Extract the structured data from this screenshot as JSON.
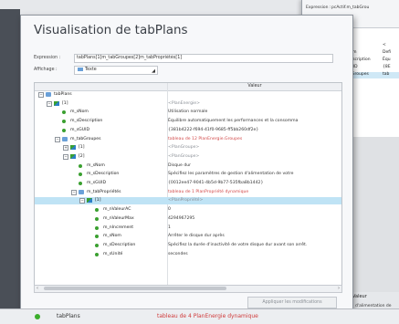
{
  "back_dialog": {
    "expression_label": "Expression :",
    "expression_value": "pcActif.m_tabGrou",
    "affichage_label": "Affichage :",
    "affichage_value": "Texte",
    "rows": [
      {
        "name": "pcActif",
        "value": "<"
      },
      {
        "name": "m_sNom",
        "value": "Defi"
      },
      {
        "name": "m_sDescription",
        "value": "Équ"
      },
      {
        "name": "m_sGUID",
        "value": "{8E"
      },
      {
        "name": "m_tabGroupes",
        "value": "tab"
      }
    ],
    "footer_header": "Valeur",
    "footer_text": "d'alimentation de"
  },
  "dialog": {
    "title": "Visualisation de tabPlans",
    "expression_label": "Expression :",
    "expression_value": "tabPlans[1]m_tabGroupes[2]m_tabPropriétés[1]",
    "affichage_label": "Affichage :",
    "affichage_value": "Texte",
    "col_name": "",
    "col_value": "Valeur",
    "rows": [
      {
        "indent": 0,
        "toggle": "−",
        "icon": "folder",
        "name": "tabPlans",
        "value": "",
        "vclass": ""
      },
      {
        "indent": 1,
        "toggle": "−",
        "icon": "link",
        "name": "[1]",
        "value": "<PlanEnergie>",
        "vclass": "gray"
      },
      {
        "indent": 2,
        "toggle": "",
        "icon": "dot",
        "name": "m_sNom",
        "value": "Utilisation normale",
        "vclass": ""
      },
      {
        "indent": 2,
        "toggle": "",
        "icon": "dot",
        "name": "m_sDescription",
        "value": "Équilibre automatiquement les performances et la consomma",
        "vclass": ""
      },
      {
        "indent": 2,
        "toggle": "",
        "icon": "dot",
        "name": "m_sGUID",
        "value": "{381b4222-f694-41f0-9685-ff5bb260df2e}",
        "vclass": ""
      },
      {
        "indent": 2,
        "toggle": "−",
        "icon": "folder",
        "name": "m_tabGroupes",
        "value": "tableau de 12 PlanEnergie.Groupes",
        "vclass": "red"
      },
      {
        "indent": 3,
        "toggle": "+",
        "icon": "link",
        "name": "[1]",
        "value": "<PlanGroupe>",
        "vclass": "gray"
      },
      {
        "indent": 3,
        "toggle": "−",
        "icon": "link",
        "name": "[2]",
        "value": "<PlanGroupe>",
        "vclass": "gray"
      },
      {
        "indent": 4,
        "toggle": "",
        "icon": "dot",
        "name": "m_sNom",
        "value": "Disque dur",
        "vclass": ""
      },
      {
        "indent": 4,
        "toggle": "",
        "icon": "dot",
        "name": "m_sDescription",
        "value": "Spécifiez les paramètres de gestion d'alimentation de votre",
        "vclass": ""
      },
      {
        "indent": 4,
        "toggle": "",
        "icon": "dot",
        "name": "m_sGUID",
        "value": "{0012ee47-9041-4b5d-9b77-535fba8b1442}",
        "vclass": ""
      },
      {
        "indent": 4,
        "toggle": "−",
        "icon": "folder",
        "name": "m_tabPropriétés",
        "value": "tableau de 1 PlanPropriété dynamique",
        "vclass": "red"
      },
      {
        "indent": 5,
        "toggle": "−",
        "icon": "link",
        "name": "[1]",
        "value": "<PlanPropriété>",
        "vclass": "gray",
        "selected": true
      },
      {
        "indent": 6,
        "toggle": "",
        "icon": "dot",
        "name": "m_nValeurAC",
        "value": "0",
        "vclass": ""
      },
      {
        "indent": 6,
        "toggle": "",
        "icon": "dot",
        "name": "m_nValeurMax",
        "value": "4294967295",
        "vclass": ""
      },
      {
        "indent": 6,
        "toggle": "",
        "icon": "dot",
        "name": "m_nIncrement",
        "value": "1",
        "vclass": ""
      },
      {
        "indent": 6,
        "toggle": "",
        "icon": "dot",
        "name": "m_sNom",
        "value": "Arrêter le disque dur après",
        "vclass": ""
      },
      {
        "indent": 6,
        "toggle": "",
        "icon": "dot",
        "name": "m_sDescription",
        "value": "Spécifiez la durée d'inactivité de votre disque dur avant son arrêt.",
        "vclass": ""
      },
      {
        "indent": 6,
        "toggle": "",
        "icon": "dot",
        "name": "m_sUnité",
        "value": "secondes",
        "vclass": ""
      }
    ],
    "apply_button": "Appliquer les modifications"
  },
  "bottom_bar": {
    "name": "tabPlans",
    "type": "tableau de 4 PlanEnergie dynamique"
  },
  "colors": {
    "accent": "#3aa030",
    "selection": "#bfe3f5",
    "red_text": "#d24a4a"
  }
}
